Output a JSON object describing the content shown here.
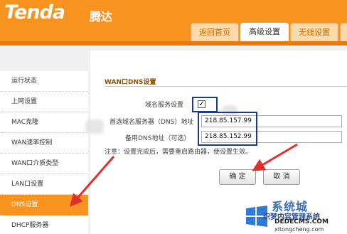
{
  "header": {
    "logo": "Tenda",
    "logo_cn": "腾达",
    "tabs": [
      {
        "label": "返回首页"
      },
      {
        "label": "高级设置"
      },
      {
        "label": "无线设置"
      }
    ]
  },
  "sidebar": {
    "items": [
      {
        "label": "运行状态"
      },
      {
        "label": "上网设置"
      },
      {
        "label": "MAC克隆"
      },
      {
        "label": "WAN速率控制"
      },
      {
        "label": "WAN口介质类型"
      },
      {
        "label": "LAN口设置"
      },
      {
        "label": "DNS设置"
      },
      {
        "label": "DHCP服务器"
      }
    ]
  },
  "dns": {
    "title": "WAN口DNS设置",
    "domain_service_label": "域名服务设置",
    "checkbox_mark": "✓",
    "primary_label": "首选域名服务器（DNS）地址",
    "primary_value": "218.85.157.99",
    "secondary_label": "备用DNS地址（可选）",
    "secondary_value": "218.85.152.99",
    "note": "注意：设置完成后，需要重启路由器，使设置生效。",
    "confirm_label": "确 定",
    "cancel_label": "取 消"
  },
  "watermark": {
    "brand": "系统城",
    "line1": "织梦内容管理系统",
    "line2": "DEDECMS.COM",
    "line3": "xitongcheng.com"
  },
  "colors": {
    "header_orange": "#f7931e",
    "highlight_blue": "#1c3a8a",
    "arrow_red": "#e0302a"
  }
}
